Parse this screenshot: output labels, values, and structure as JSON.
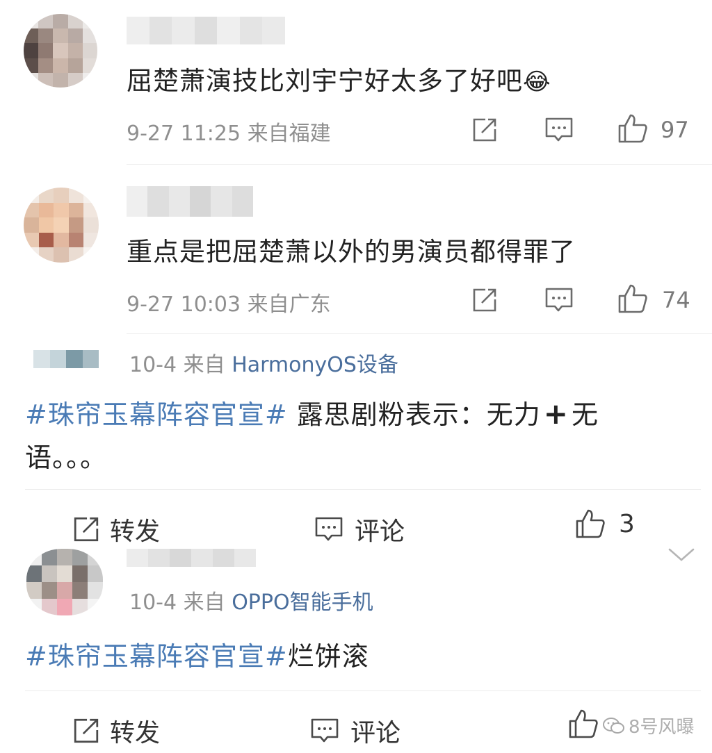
{
  "comments": [
    {
      "text": "屈楚萧演技比刘宇宁好太多了好吧",
      "emoji": "😂",
      "time": "9-27 11:25",
      "location": "来自福建",
      "likes": "97"
    },
    {
      "text": "重点是把屈楚萧以外的男演员都得罪了",
      "time": "9-27 10:03",
      "location": "来自广东",
      "likes": "74"
    }
  ],
  "posts": [
    {
      "date": "10-4",
      "from": "来自",
      "device": "HarmonyOS设备",
      "hashtag": "#珠帘玉幕阵容官宣#",
      "text_line1": "露思剧粉表示：无力",
      "plus": "+",
      "text_line1_end": "无",
      "text_line2": "语。。。",
      "repost_label": "转发",
      "comment_label": "评论",
      "likes": "3"
    },
    {
      "date": "10-4",
      "from": "来自",
      "device": "OPPO智能手机",
      "hashtag": "#珠帘玉幕阵容官宣#",
      "text": "烂饼滚",
      "repost_label": "转发",
      "comment_label": "评论"
    }
  ],
  "watermark": "8号风曝",
  "colors": {
    "hashtag": "#4a7bb5",
    "meta": "#8f8f8f",
    "divider": "#ececec"
  },
  "icons": [
    "share-icon",
    "comment-icon",
    "like-icon",
    "chevron-down-icon",
    "wechat-icon"
  ]
}
